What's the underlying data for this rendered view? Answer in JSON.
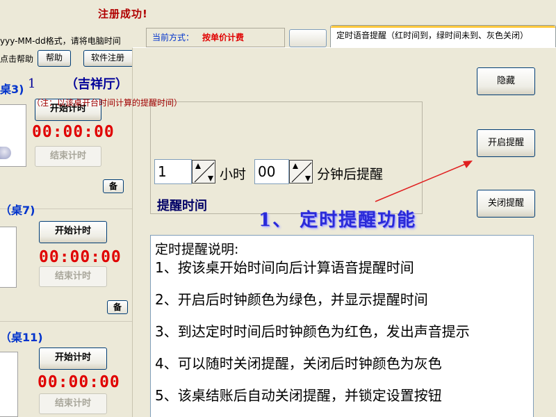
{
  "top": {
    "success_message": "注册成功!"
  },
  "left": {
    "format_note": "yyy-MM-dd格式，请将电脑时间",
    "help_prefix": "点击帮助",
    "help_button": "帮助",
    "register_button": "软件注册",
    "tables": [
      {
        "title": "桌3)",
        "start_label": "开始计时",
        "timer": "00:00:00",
        "end_label": "结束计时",
        "bei_label": "备"
      },
      {
        "title": "（桌7)",
        "start_label": "开始计时",
        "timer": "00:00:00",
        "end_label": "结束计时",
        "bei_label": "备"
      },
      {
        "title": "（桌11)",
        "start_label": "开始计时",
        "timer": "00:00:00",
        "end_label": "结束计时"
      }
    ]
  },
  "mode": {
    "label": "当前方式：",
    "value": "按单价计费"
  },
  "tab": {
    "label": "定时语音提醒（红时间到，绿时间未到、灰色关闭）"
  },
  "dialog": {
    "table_number": "1",
    "hall_name": "（吉祥厅）",
    "calc_note": "（注：以该桌开台时间计算的提醒时间）",
    "hours_value": "1",
    "hours_unit": "小时",
    "minutes_value": "00",
    "minutes_unit": "分钟后提醒",
    "remind_time_label": "提醒时间",
    "hide_button": "隐藏",
    "open_button": "开启提醒",
    "close_button": "关闭提醒",
    "instructions": {
      "title": "定时提醒说明:",
      "lines": [
        "1、按该桌开始时间向后计算语音提醒时间",
        "2、开启后时钟颜色为绿色，并显示提醒时间",
        "3、到达定时时间后时钟颜色为红色，发出声音提示",
        "4、可以随时关闭提醒，关闭后时钟颜色为灰色",
        "5、该桌结账后自动关闭提醒，并锁定设置按钮"
      ]
    }
  },
  "annotation": {
    "caption": "1、 定时提醒功能",
    "arrow_color": "#e02020",
    "caption_color": "#2a2ad8"
  }
}
